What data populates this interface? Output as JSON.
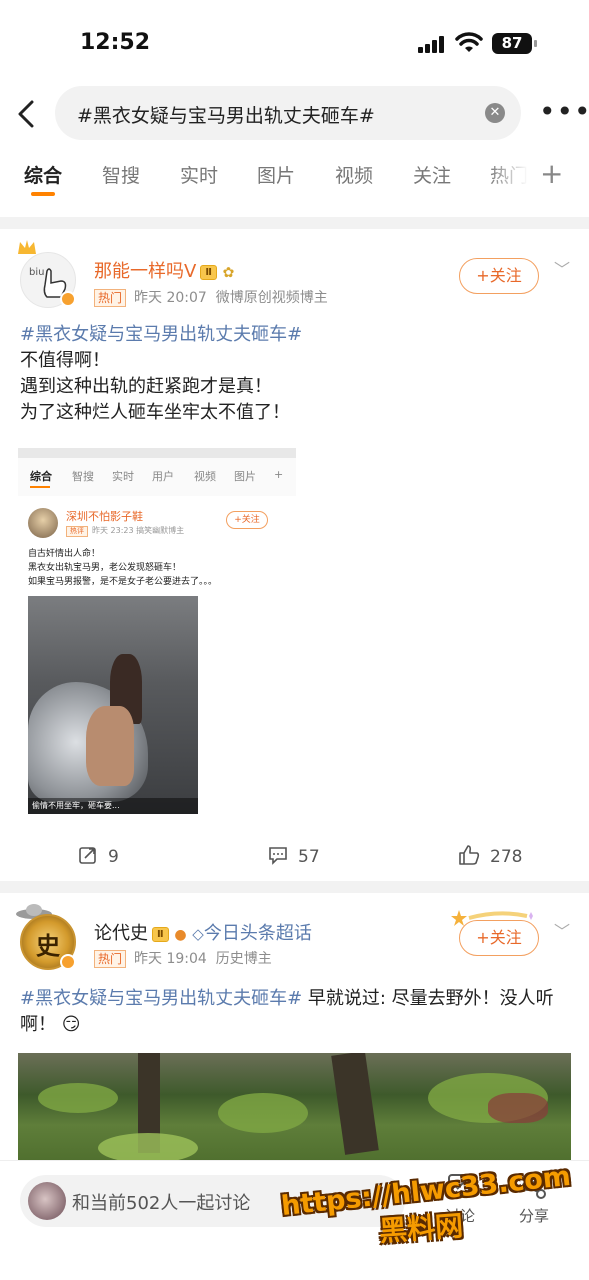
{
  "status": {
    "time": "12:52",
    "battery": "87"
  },
  "search": {
    "query": "#黑衣女疑与宝马男出轨丈夫砸车#"
  },
  "tabs": [
    {
      "label": "综合"
    },
    {
      "label": "智搜"
    },
    {
      "label": "实时"
    },
    {
      "label": "图片"
    },
    {
      "label": "视频"
    },
    {
      "label": "关注"
    },
    {
      "label": "热门"
    }
  ],
  "posts": [
    {
      "author": "那能一样吗Ⅴ",
      "level": "Ⅱ",
      "hot": "热门",
      "time": "昨天 20:07",
      "desc": "微博原创视频博主",
      "follow": "+关注",
      "topic": "#黑衣女疑与宝马男出轨丈夫砸车#",
      "lines": [
        "不值得啊！",
        "遇到这种出轨的赶紧跑才是真！",
        "为了这种烂人砸车坐牢太不值了！"
      ],
      "embed": {
        "tabs": [
          "综合",
          "智搜",
          "实时",
          "用户",
          "视频",
          "图片"
        ],
        "author": "深圳不怕影子鞋",
        "hot": "热评",
        "time": "昨天 23:23",
        "desc": "搞笑幽默博主",
        "follow": "+关注",
        "lines": [
          "自古奸情出人命！",
          "黑衣女出轨宝马男，老公发现怒砸车！",
          "如果宝马男报警，是不是女子老公要进去了。。。"
        ],
        "caption": "偷情不用坐牢，砸车要..."
      },
      "actions": {
        "share": "9",
        "comment": "57",
        "like": "278"
      }
    },
    {
      "author": "论代史",
      "level": "Ⅱ",
      "super_topic": "今日头条超话",
      "hot": "热门",
      "time": "昨天 19:04",
      "desc": "历史博主",
      "follow": "+关注",
      "topic": "#黑衣女疑与宝马男出轨丈夫砸车#",
      "text1": " 早就说过: 尽量去野外！没人听",
      "text2": "啊！"
    }
  ],
  "bottom": {
    "discuss": "和当前502人一起讨论",
    "comment_label": "讨论",
    "share_label": "分享"
  },
  "watermark": {
    "line1": "https://hlwc33.com",
    "line2": "黑料网"
  },
  "colors": {
    "accent": "#ff8200",
    "topic": "#5b7bad",
    "author": "#e8692a"
  }
}
